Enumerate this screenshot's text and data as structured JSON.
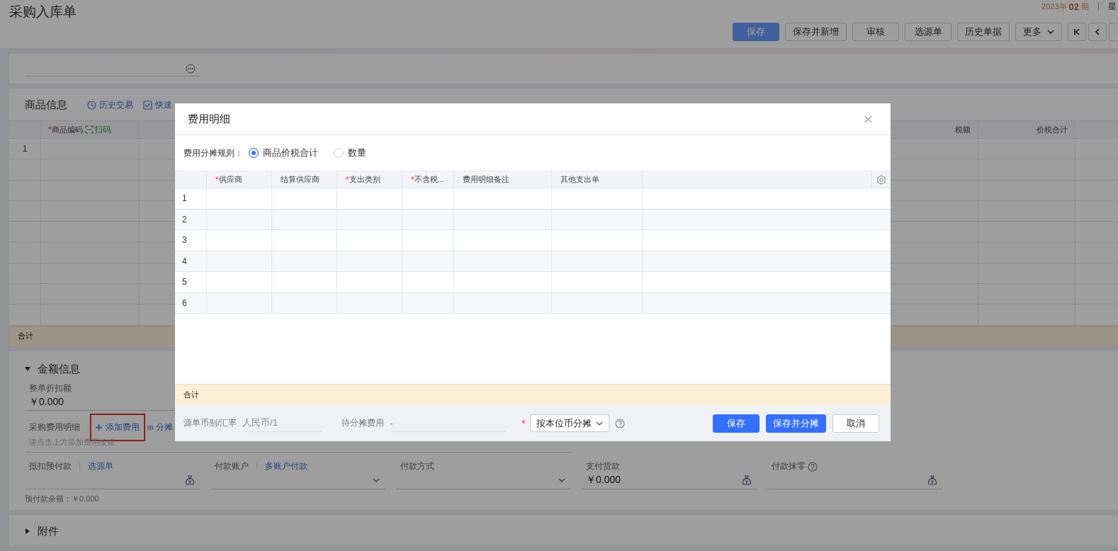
{
  "page": {
    "title": "采购入库单",
    "period": {
      "year": "2023年",
      "number": "02",
      "unit": "期"
    },
    "weekday": "星"
  },
  "toolbar": [
    {
      "label": "保存",
      "kind": "primary"
    },
    {
      "label": "保存并新增",
      "kind": "plain"
    },
    {
      "label": "审核",
      "kind": "plain"
    },
    {
      "label": "选源单",
      "kind": "plain"
    },
    {
      "label": "历史单据",
      "kind": "plain"
    },
    {
      "label": "更多",
      "kind": "dropdown"
    },
    {
      "kind": "first"
    },
    {
      "kind": "prev"
    },
    {
      "kind": "cut"
    }
  ],
  "goods": {
    "title": "商品信息",
    "actions": [
      {
        "label": "历史交易",
        "kind": "history"
      },
      {
        "label": "快速",
        "kind": "check"
      }
    ],
    "columns": [
      {
        "label": "商品编码",
        "required_mark": "*",
        "scan": "扫码",
        "kind": "code"
      },
      {
        "kind": "hidden"
      },
      {
        "label": "税额",
        "kind": "number"
      },
      {
        "label": "价税合计",
        "kind": "number"
      },
      {
        "kind": "more"
      }
    ],
    "rows": [
      {
        "index": "1"
      }
    ],
    "total": "合计"
  },
  "amount": {
    "title": "金额信息",
    "expanded": true,
    "discount": {
      "label": "整单折扣额",
      "value": "￥0.000"
    },
    "fee": {
      "label": "采购费用明细",
      "add": "添加费用",
      "highlighted": true,
      "split": "分摊",
      "hint": "请点击上方添加费用按钮"
    },
    "payment_fields": [
      {
        "label": "抵扣预付款",
        "link": "选源单",
        "kind": "money"
      },
      {
        "label": "付款账户",
        "link": "多账户付款",
        "kind": "select"
      },
      {
        "label": "付款方式",
        "kind": "select"
      },
      {
        "label": "支付货款",
        "value": "￥0.000",
        "kind": "money"
      },
      {
        "label": "付款抹零",
        "help": true,
        "kind": "money"
      }
    ],
    "prepaid_balance": "预付款余额：￥0.000"
  },
  "attachments": {
    "title": "附件",
    "expanded": false
  },
  "dialog": {
    "title": "费用明细",
    "rule": {
      "label": "费用分摊规则：",
      "options": [
        {
          "label": "商品价税合计",
          "selected": true
        },
        {
          "label": "数量",
          "selected": false
        }
      ]
    },
    "columns": [
      {
        "label": "供应商",
        "required_mark": "*"
      },
      {
        "label": "结算供应商"
      },
      {
        "label": "支出类别",
        "required_mark": "*"
      },
      {
        "label": "不含税...",
        "required_mark": "*"
      },
      {
        "label": "费用明细备注"
      },
      {
        "label": "其他支出单"
      }
    ],
    "rows": [
      {
        "index": "1"
      },
      {
        "index": "2"
      },
      {
        "index": "3"
      },
      {
        "index": "4"
      },
      {
        "index": "5"
      },
      {
        "index": "6"
      }
    ],
    "total": "合计",
    "currency": {
      "label": "源单币别/汇率",
      "value": "人民币/1"
    },
    "pending": {
      "label": "待分摊费用",
      "value": "-"
    },
    "split_mode": {
      "value": "按本位币分摊",
      "required_mark": "*"
    },
    "buttons": [
      {
        "label": "保存",
        "kind": "primary"
      },
      {
        "label": "保存并分摊",
        "kind": "primary"
      },
      {
        "label": "取消",
        "kind": "plain"
      }
    ]
  }
}
